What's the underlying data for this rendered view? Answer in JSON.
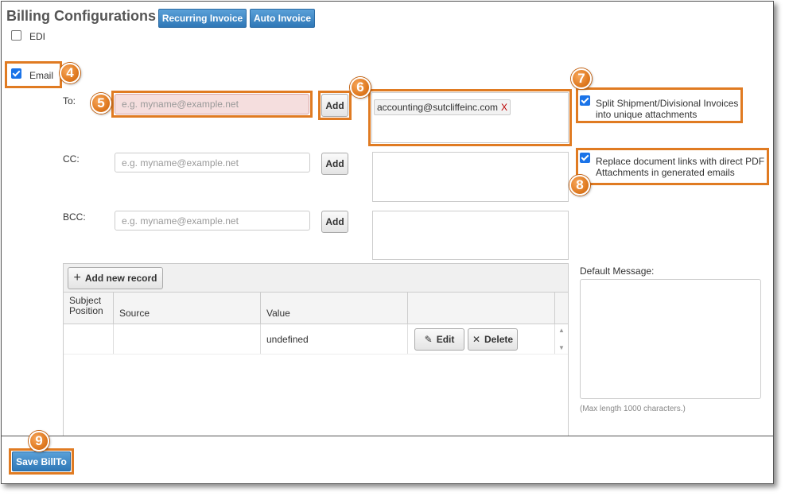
{
  "header": {
    "title": "Billing Configurations",
    "recurring_invoice": "Recurring Invoice",
    "auto_invoice": "Auto Invoice"
  },
  "edi": {
    "label": "EDI",
    "checked": false
  },
  "email": {
    "label": "Email",
    "checked": true
  },
  "markers": {
    "m4": "4",
    "m5": "5",
    "m6": "6",
    "m7": "7",
    "m8": "8",
    "m9": "9"
  },
  "to": {
    "label": "To:",
    "placeholder": "e.g. myname@example.net",
    "add_label": "Add",
    "chip": {
      "text": "accounting@sutcliffeinc.com",
      "remove": "X"
    }
  },
  "cc": {
    "label": "CC:",
    "placeholder": "e.g. myname@example.net",
    "add_label": "Add"
  },
  "bcc": {
    "label": "BCC:",
    "placeholder": "e.g. myname@example.net",
    "add_label": "Add"
  },
  "options": {
    "split": {
      "label_line1": "Split Shipment/Divisional Invoices",
      "label_line2": "into unique attachments",
      "checked": true
    },
    "replace": {
      "label_line1": "Replace document links with direct PDF",
      "label_line2": "Attachments in generated emails",
      "checked": true
    }
  },
  "grid": {
    "add_record": "Add new record",
    "columns": [
      "Subject\nPosition",
      "Source",
      "Value",
      ""
    ],
    "rows": [
      {
        "subject_position": "",
        "source": "",
        "value": "undefined",
        "edit": "Edit",
        "delete": "Delete"
      }
    ]
  },
  "default_message": {
    "label": "Default Message:",
    "hint": "(Max length 1000 characters.)"
  },
  "footer": {
    "save_label": "Save BillTo"
  },
  "colors": {
    "accent_orange": "#e07b22",
    "primary_blue": "#2f78b7"
  }
}
